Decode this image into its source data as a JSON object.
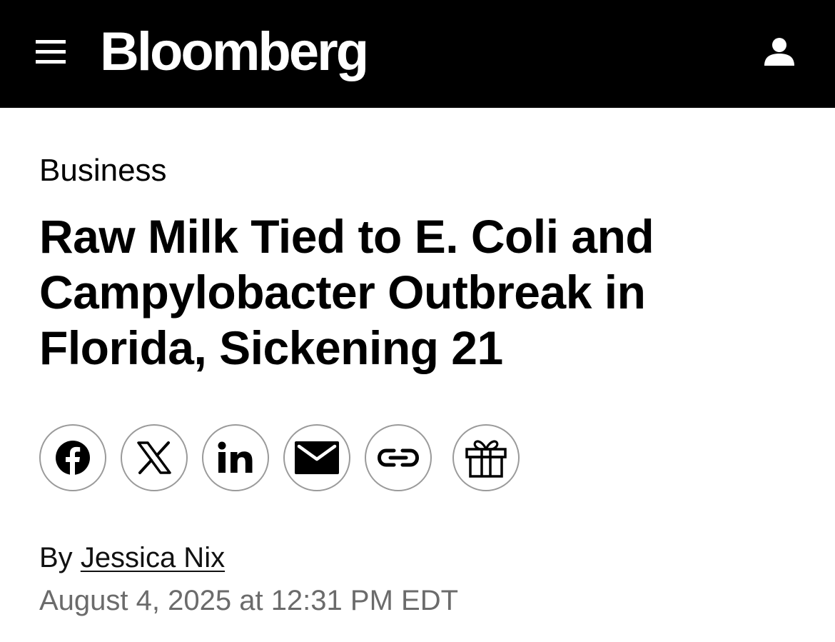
{
  "header": {
    "brand": "Bloomberg",
    "menu_icon": "hamburger-menu-icon",
    "account_icon": "user-account-icon",
    "background": "#000000",
    "foreground": "#ffffff"
  },
  "article": {
    "section": "Business",
    "headline": "Raw Milk Tied to E. Coli and Campylobacter Outbreak in Florida, Sickening 21",
    "byline_prefix": "By",
    "author": "Jessica Nix",
    "date": "August 4, 2025 at 12:31 PM EDT"
  },
  "share": {
    "buttons": [
      {
        "name": "facebook",
        "icon": "facebook-icon"
      },
      {
        "name": "x",
        "icon": "x-icon"
      },
      {
        "name": "linkedin",
        "icon": "linkedin-icon"
      },
      {
        "name": "email",
        "icon": "email-icon"
      },
      {
        "name": "copy-link",
        "icon": "link-icon"
      },
      {
        "name": "gift",
        "icon": "gift-icon"
      }
    ]
  },
  "colors": {
    "text": "#000000",
    "muted": "#6b6b6b",
    "button_border": "#9a9a9a"
  }
}
